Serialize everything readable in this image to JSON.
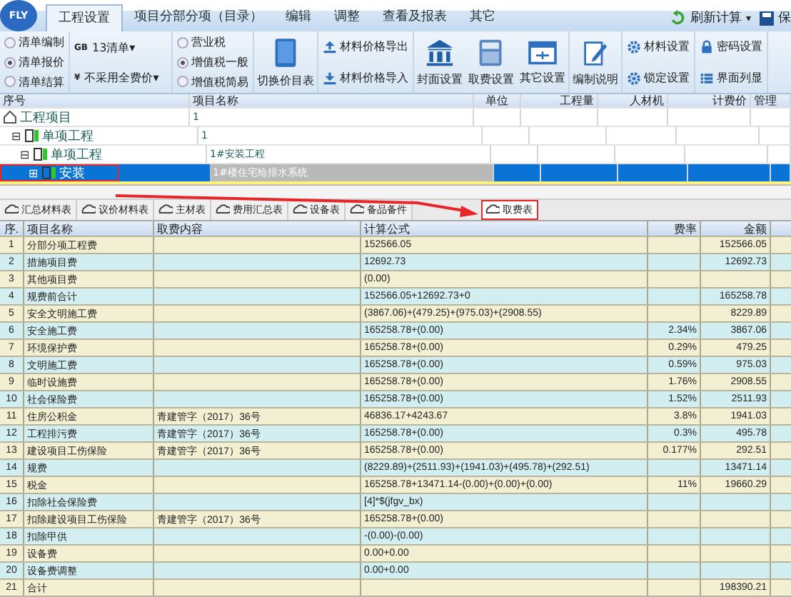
{
  "logo": "FLY",
  "ribbon_tabs": [
    {
      "label": "工程设置",
      "selected": true
    },
    {
      "label": "项目分部分项（目录）",
      "selected": false
    },
    {
      "label": "编辑",
      "selected": false
    },
    {
      "label": "调整",
      "selected": false
    },
    {
      "label": "查看及报表",
      "selected": false
    },
    {
      "label": "其它",
      "selected": false
    }
  ],
  "quick_actions": [
    {
      "label": "刷新计算",
      "caret": "▾",
      "kind": "refresh"
    },
    {
      "label": "保",
      "kind": "save"
    }
  ],
  "ribbon_groups": [
    {
      "kind": "radios",
      "items": [
        {
          "label": "清单编制",
          "selected": false
        },
        {
          "label": "清单报价",
          "selected": true
        },
        {
          "label": "清单结算",
          "selected": false
        }
      ]
    },
    {
      "kind": "dropdowns",
      "items": [
        {
          "prefix": "GB",
          "label": "13清单▾"
        },
        {
          "prefix": "¥",
          "label": "不采用全费价▾"
        }
      ]
    },
    {
      "kind": "radios",
      "items": [
        {
          "label": "营业税",
          "selected": false
        },
        {
          "label": "增值税一般",
          "selected": true
        },
        {
          "label": "增值税简易",
          "selected": false
        }
      ]
    },
    {
      "kind": "big",
      "items": [
        {
          "label": "切换价目表"
        }
      ]
    },
    {
      "kind": "small",
      "items": [
        {
          "label": "材料价格导出"
        },
        {
          "label": "材料价格导入"
        }
      ]
    },
    {
      "kind": "big",
      "items": [
        {
          "label": "封面设置"
        },
        {
          "label": "取费设置"
        },
        {
          "label": "其它设置"
        }
      ]
    },
    {
      "kind": "big",
      "items": [
        {
          "label": "编制说明"
        }
      ]
    },
    {
      "kind": "small",
      "items": [
        {
          "label": "材料设置"
        },
        {
          "label": "锁定设置"
        }
      ]
    },
    {
      "kind": "small",
      "items": [
        {
          "label": "密码设置"
        },
        {
          "label": "界面列显"
        }
      ]
    }
  ],
  "tree_grid": {
    "columns": [
      "序号",
      "项目名称",
      "单位",
      "工程量",
      "人材机",
      "计费价",
      "管理"
    ],
    "rows": [
      {
        "label": "工程项目",
        "name": "1",
        "kind": "project",
        "selected": false,
        "children": [
          {
            "toggle": "⊟",
            "label": "单项工程",
            "name": "1",
            "kind": "unit",
            "selected": false,
            "children": [
              {
                "toggle": "⊟",
                "label": "单项工程",
                "name": "1#安装工程",
                "kind": "unit",
                "selected": false,
                "children": [
                  {
                    "toggle": "⊞",
                    "label": "安装",
                    "name": "1#楼住宅给排水系统",
                    "kind": "unit",
                    "selected": true
                  }
                ]
              }
            ]
          }
        ]
      }
    ]
  },
  "report_tabs": [
    {
      "label": "汇总材料表",
      "selected": false
    },
    {
      "label": "议价材料表",
      "selected": false
    },
    {
      "label": "主材表",
      "selected": false
    },
    {
      "label": "费用汇总表",
      "selected": false
    },
    {
      "label": "设备表",
      "selected": false
    },
    {
      "label": "备品备件",
      "selected": false
    },
    {
      "label": "取费表",
      "selected": true
    }
  ],
  "fee_table": {
    "columns": [
      "序.",
      "项目名称",
      "取费内容",
      "计算公式",
      "费率",
      "金额"
    ],
    "rows": [
      [
        "1",
        "分部分项工程费",
        "",
        "152566.05",
        "",
        "152566.05"
      ],
      [
        "2",
        "措施项目费",
        "",
        "12692.73",
        "",
        "12692.73"
      ],
      [
        "3",
        "其他项目费",
        "",
        "(0.00)",
        "",
        ""
      ],
      [
        "4",
        "规费前合计",
        "",
        "152566.05+12692.73+0",
        "",
        "165258.78"
      ],
      [
        "5",
        "安全文明施工费",
        "",
        "(3867.06)+(479.25)+(975.03)+(2908.55)",
        "",
        "8229.89"
      ],
      [
        "6",
        "安全施工费",
        "",
        "165258.78+(0.00)",
        "2.34%",
        "3867.06"
      ],
      [
        "7",
        "环境保护费",
        "",
        "165258.78+(0.00)",
        "0.29%",
        "479.25"
      ],
      [
        "8",
        "文明施工费",
        "",
        "165258.78+(0.00)",
        "0.59%",
        "975.03"
      ],
      [
        "9",
        "临时设施费",
        "",
        "165258.78+(0.00)",
        "1.76%",
        "2908.55"
      ],
      [
        "10",
        "社会保险费",
        "",
        "165258.78+(0.00)",
        "1.52%",
        "2511.93"
      ],
      [
        "11",
        "住房公积金",
        "青建管字（2017）36号",
        "46836.17+4243.67",
        "3.8%",
        "1941.03"
      ],
      [
        "12",
        "工程排污费",
        "青建管字（2017）36号",
        "165258.78+(0.00)",
        "0.3%",
        "495.78"
      ],
      [
        "13",
        "建设项目工伤保险",
        "青建管字（2017）36号",
        "165258.78+(0.00)",
        "0.177%",
        "292.51"
      ],
      [
        "14",
        "规费",
        "",
        "(8229.89)+(2511.93)+(1941.03)+(495.78)+(292.51)",
        "",
        "13471.14"
      ],
      [
        "15",
        "税金",
        "",
        "165258.78+13471.14-(0.00)+(0.00)+(0.00)",
        "11%",
        "19660.29"
      ],
      [
        "16",
        "扣除社会保险费",
        "",
        "[4]*$(jfgv_bx)",
        "",
        ""
      ],
      [
        "17",
        "扣除建设项目工伤保险",
        "青建管字（2017）36号",
        "165258.78+(0.00)",
        "",
        ""
      ],
      [
        "18",
        "扣除甲供",
        "",
        "-(0.00)-(0.00)",
        "",
        ""
      ],
      [
        "19",
        "设备费",
        "",
        "0.00+0.00",
        "",
        ""
      ],
      [
        "20",
        "设备费调整",
        "",
        "0.00+0.00",
        "",
        ""
      ],
      [
        "21",
        "合计",
        "",
        "",
        "",
        "198390.21"
      ]
    ]
  }
}
